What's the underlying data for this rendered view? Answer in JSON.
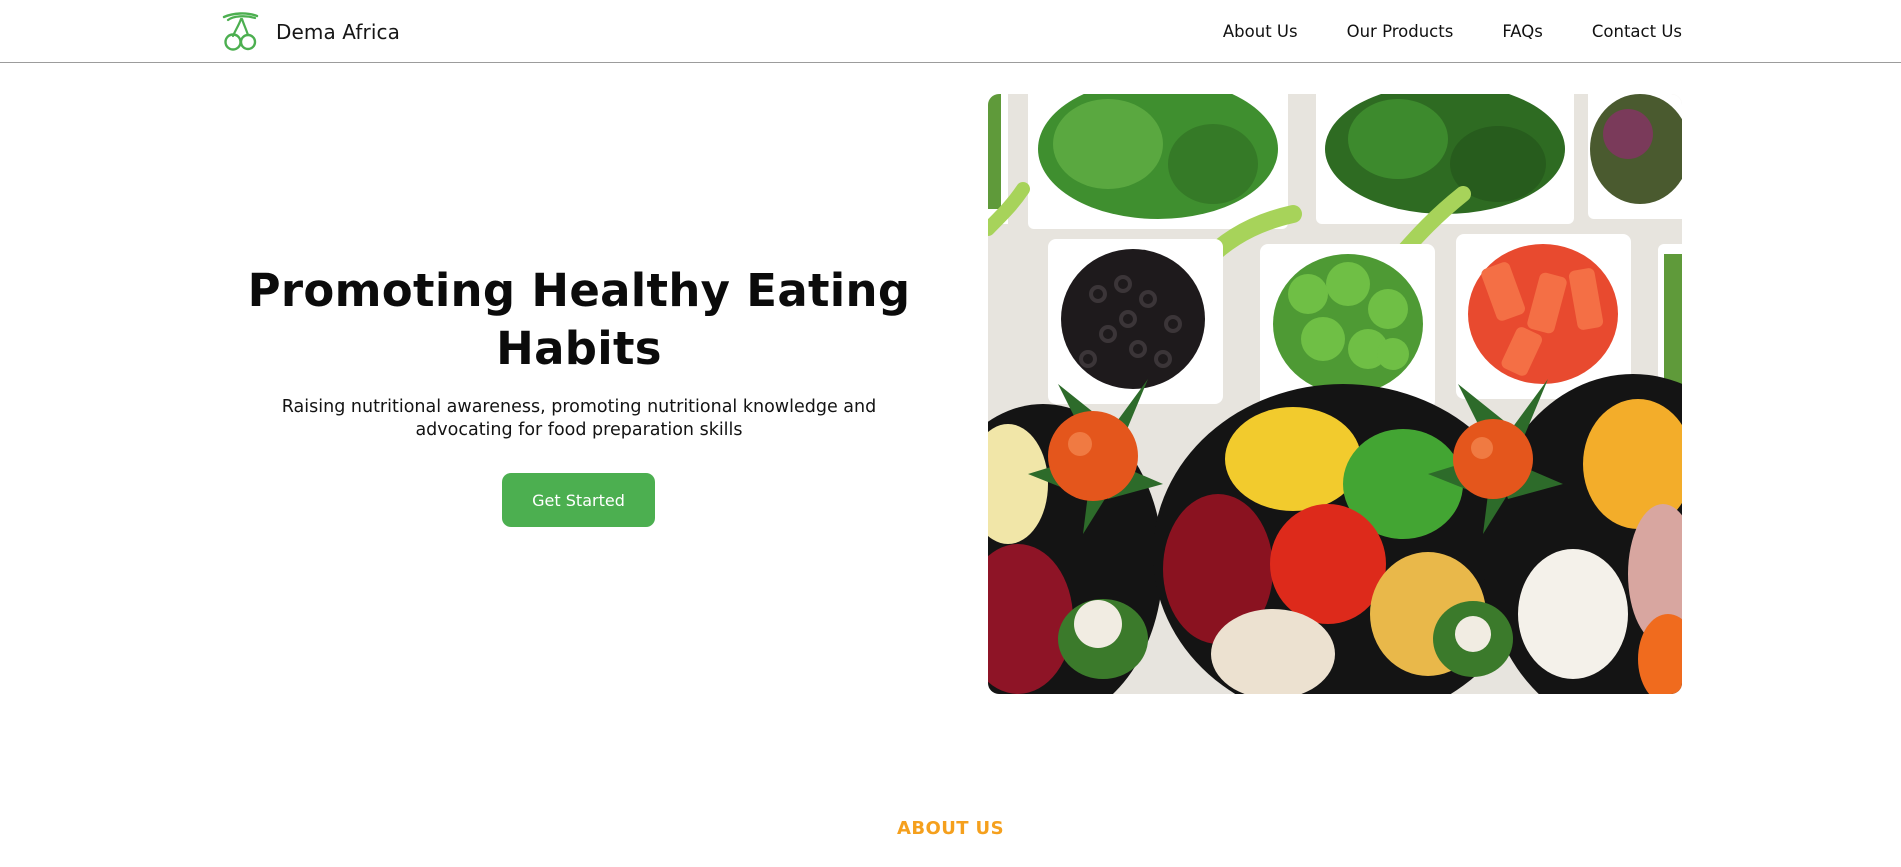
{
  "brand": {
    "name": "Dema Africa",
    "logo_icon": "cherries-logo-icon",
    "color": "#4caf50"
  },
  "nav": {
    "items": [
      {
        "label": "About Us"
      },
      {
        "label": "Our Products"
      },
      {
        "label": "FAQs"
      },
      {
        "label": "Contact Us"
      }
    ]
  },
  "hero": {
    "title": "Promoting Healthy Eating Habits",
    "subtitle": "Raising nutritional awareness, promoting nutritional knowledge and advocating for food preparation skills",
    "cta_label": "Get Started",
    "cta_color": "#4caf50",
    "image_subject": "salad-bar-vegetables-image"
  },
  "sections": {
    "about_label": "ABOUT US",
    "about_color": "#f5a01d"
  }
}
